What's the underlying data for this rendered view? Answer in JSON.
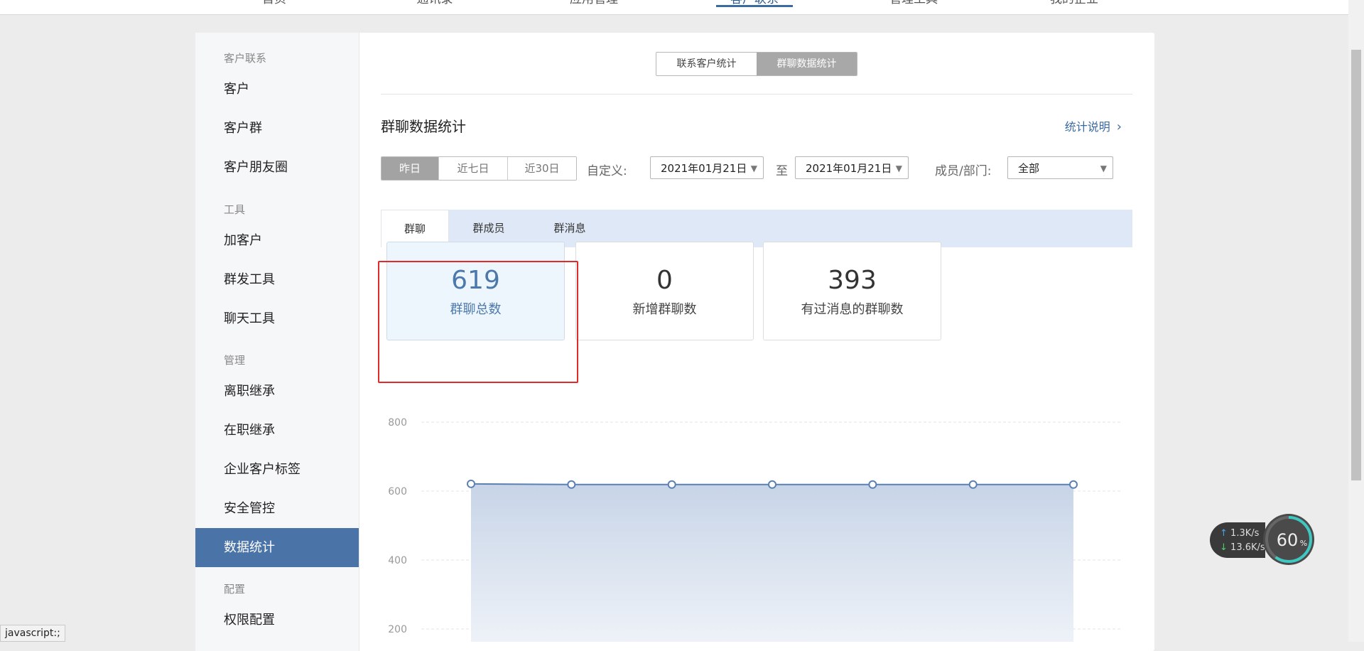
{
  "top_nav": {
    "tabs": [
      {
        "label": "首页"
      },
      {
        "label": "通讯录"
      },
      {
        "label": "应用管理"
      },
      {
        "label": "客户联系"
      },
      {
        "label": "管理工具"
      },
      {
        "label": "我的企业"
      }
    ],
    "active_index": 3
  },
  "sidebar": {
    "sections": [
      {
        "title": "客户联系",
        "items": [
          "客户",
          "客户群",
          "客户朋友圈"
        ]
      },
      {
        "title": "工具",
        "items": [
          "加客户",
          "群发工具",
          "聊天工具"
        ]
      },
      {
        "title": "管理",
        "items": [
          "离职继承",
          "在职继承",
          "企业客户标签",
          "安全管控",
          "数据统计"
        ]
      },
      {
        "title": "配置",
        "items": [
          "权限配置"
        ]
      }
    ],
    "active_item": "数据统计"
  },
  "segment": {
    "options": [
      "联系客户统计",
      "群聊数据统计"
    ],
    "active_index": 1
  },
  "page_title": "群聊数据统计",
  "explain_link": "统计说明",
  "explain_chevron": "›",
  "filters": {
    "range_options": [
      "昨日",
      "近七日",
      "近30日"
    ],
    "range_active_index": 0,
    "custom_label": "自定义:",
    "date_from": "2021年01月21日",
    "to_label": "至",
    "date_to": "2021年01月21日",
    "member_label": "成员/部门:",
    "member_value": "全部",
    "caret": "▼"
  },
  "subtabs": {
    "options": [
      "群聊",
      "群成员",
      "群消息"
    ],
    "active_index": 0
  },
  "stats": [
    {
      "value": "619",
      "caption": "群聊总数",
      "active": true
    },
    {
      "value": "0",
      "caption": "新增群聊数",
      "active": false
    },
    {
      "value": "393",
      "caption": "有过消息的群聊数",
      "active": false
    }
  ],
  "chart_data": {
    "type": "area",
    "x": [
      "1",
      "2",
      "3",
      "4",
      "5",
      "6",
      "7"
    ],
    "values": [
      621,
      619,
      619,
      619,
      619,
      619,
      619
    ],
    "ylim": [
      0,
      800
    ],
    "yticks": [
      200,
      400,
      600,
      800
    ],
    "grid": true,
    "color": "#5b80b2"
  },
  "status_bar": "javascript:;",
  "network": {
    "up": "1.3K/s",
    "down": "13.6K/s",
    "up_arrow": "↑",
    "down_arrow": "↓",
    "gauge_value": "60",
    "gauge_unit": "%"
  },
  "colors": {
    "accent": "#4a73a8",
    "highlight": "#e12a2a",
    "link": "#3b6aa0"
  }
}
